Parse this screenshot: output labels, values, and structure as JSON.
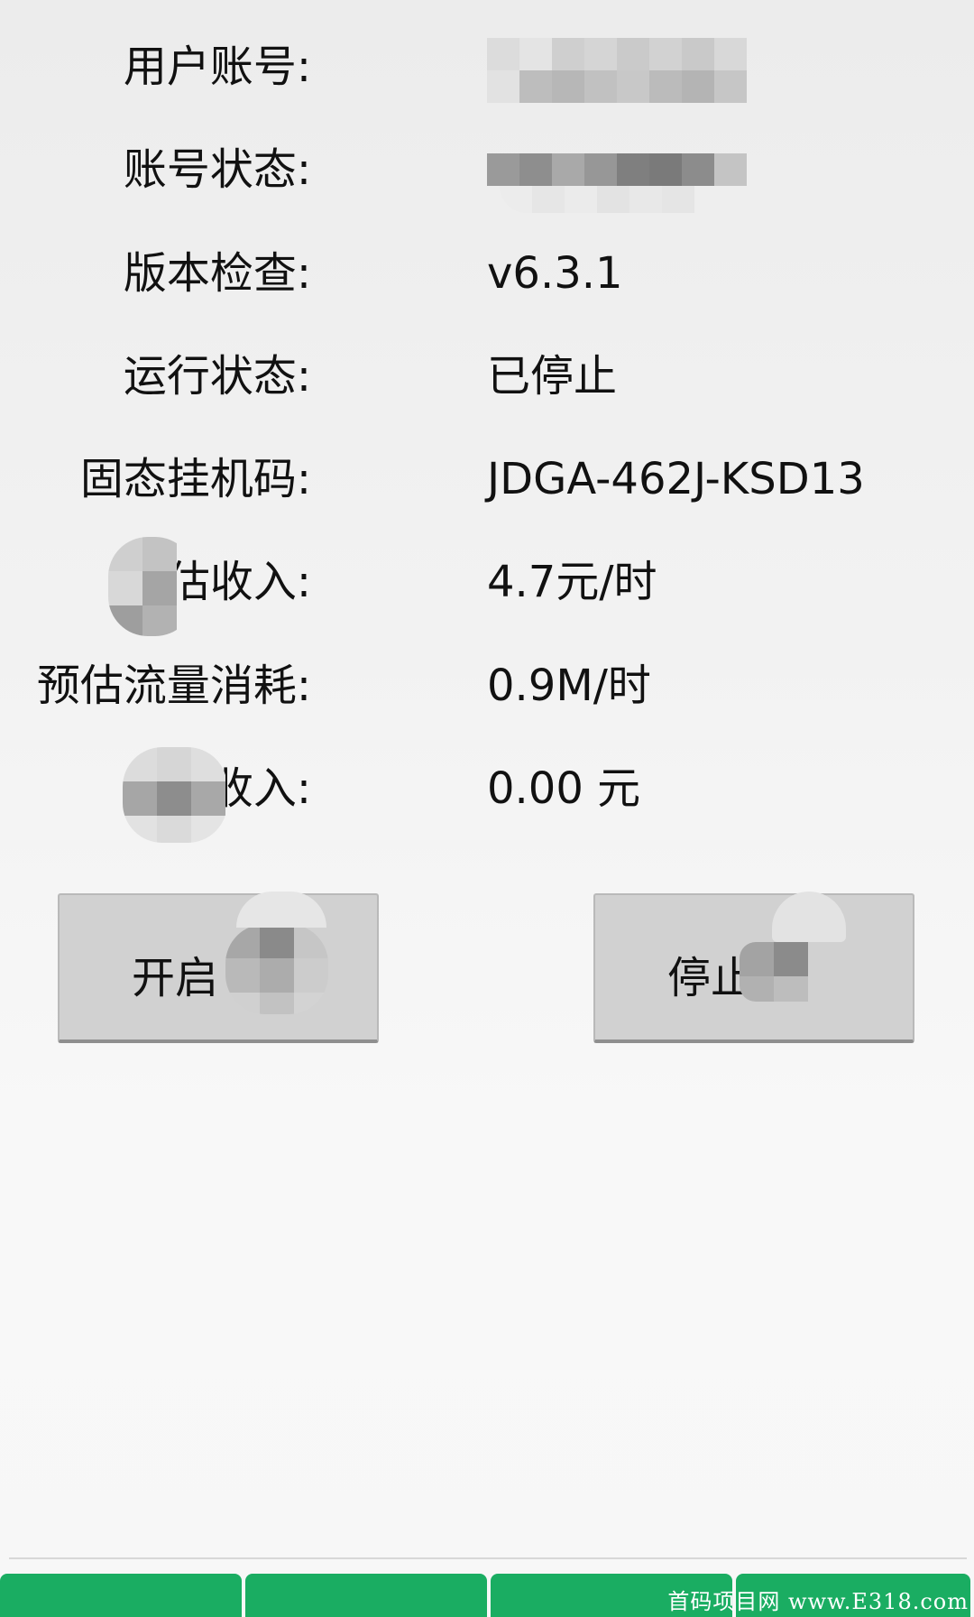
{
  "fields": [
    {
      "label": "用户账号:",
      "value": ""
    },
    {
      "label": "账号状态:",
      "value": ""
    },
    {
      "label": "版本检查:",
      "value": "v6.3.1"
    },
    {
      "label": "运行状态:",
      "value": "已停止"
    },
    {
      "label": "固态挂机码:",
      "value": "JDGA-462J-KSD13"
    },
    {
      "label": "预估收入:",
      "value": "4.7元/时"
    },
    {
      "label": "预估流量消耗:",
      "value": "0.9M/时"
    },
    {
      "label": "本次收入:",
      "value": "0.00 元"
    }
  ],
  "buttons": {
    "start_label": "开启",
    "stop_label": "停止"
  },
  "tabs": [
    "",
    "",
    "",
    ""
  ],
  "watermark": "首码项目网 www.E318.com",
  "colors": {
    "tab_green": "#1aad62",
    "button_gray": "#d1d1d1",
    "text": "#111111"
  }
}
